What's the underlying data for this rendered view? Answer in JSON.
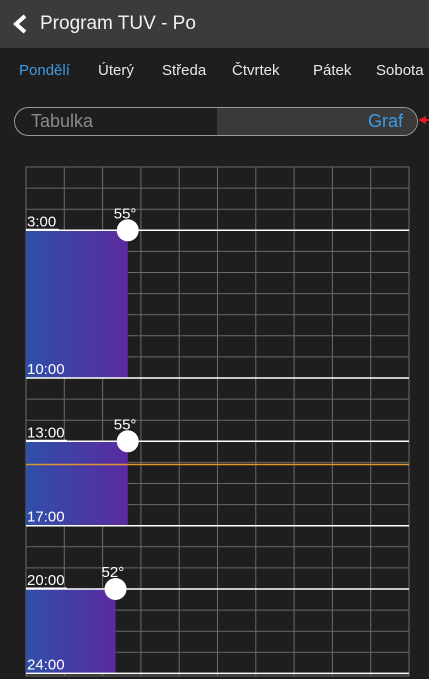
{
  "header": {
    "title": "Program TUV - Po"
  },
  "days": [
    "Pondělí",
    "Úterý",
    "Středa",
    "Čtvrtek",
    "Pátek",
    "Sobota"
  ],
  "active_day": 0,
  "view_toggle": {
    "left": "Tabulka",
    "right": "Graf",
    "selected": "right"
  },
  "schedule": [
    {
      "start": "3:00",
      "end": "10:00",
      "temp_label": "55°"
    },
    {
      "start": "13:00",
      "end": "17:00",
      "temp_label": "55°"
    },
    {
      "start": "20:00",
      "end": "24:00",
      "temp_label": "52°"
    }
  ],
  "colors": {
    "accent": "#3e9be5",
    "bar_start": "#2f4fa8",
    "bar_end": "#5a2aa0",
    "current_time_line": "#e0962a"
  }
}
